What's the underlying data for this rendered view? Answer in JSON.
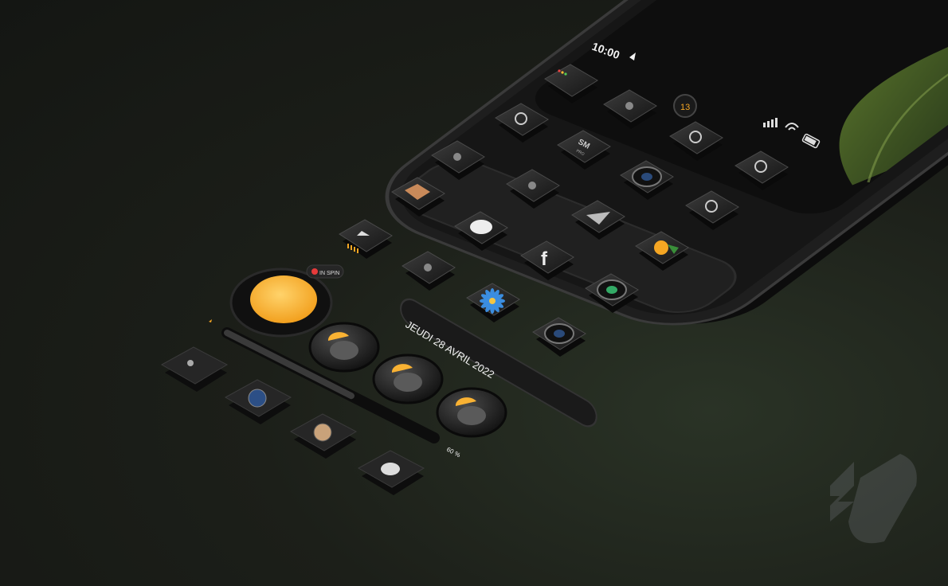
{
  "status_bar": {
    "time": "10:00",
    "icons": [
      "location-arrow-icon",
      "signal-icon",
      "wifi-icon",
      "battery-icon"
    ]
  },
  "widgets": {
    "date_label": "JEUDI 28 AVRIL 2022",
    "battery_percent_label": "60 %",
    "battery_level": 0.6,
    "calendar_badge": "13",
    "pill_label": "IN SPIN"
  },
  "apps": [
    {
      "name": "finder-icon"
    },
    {
      "name": "grille-icon"
    },
    {
      "name": "stethoscope-icon"
    },
    {
      "name": "calendar-icon"
    },
    {
      "name": "maps-pin-icon"
    },
    {
      "name": "watch-icon"
    },
    {
      "name": "sm-pro-icon"
    },
    {
      "name": "amazon-icon"
    },
    {
      "name": "batman-icon"
    },
    {
      "name": "connect-icon"
    },
    {
      "name": "speaker-icon"
    },
    {
      "name": "eyes-icon"
    },
    {
      "name": "drive-icon"
    },
    {
      "name": "messages-icon"
    },
    {
      "name": "paper-plane-icon"
    },
    {
      "name": "notes-icon"
    },
    {
      "name": "facebook-icon"
    },
    {
      "name": "orange-app-icon"
    },
    {
      "name": "flower-icon"
    },
    {
      "name": "camera-icon"
    },
    {
      "name": "lens-icon"
    }
  ],
  "dock": [
    "camera-dock-icon",
    "compass-icon",
    "music-icon",
    "moon-icon"
  ],
  "icon_letters": {
    "sm": "SM",
    "pro": "PRO",
    "facebook": "f"
  },
  "colors": {
    "accent": "#f5a623",
    "weather_sun": "#f9b233",
    "leaf": "#3d5a22",
    "phone_body": "#1e1e1e"
  }
}
